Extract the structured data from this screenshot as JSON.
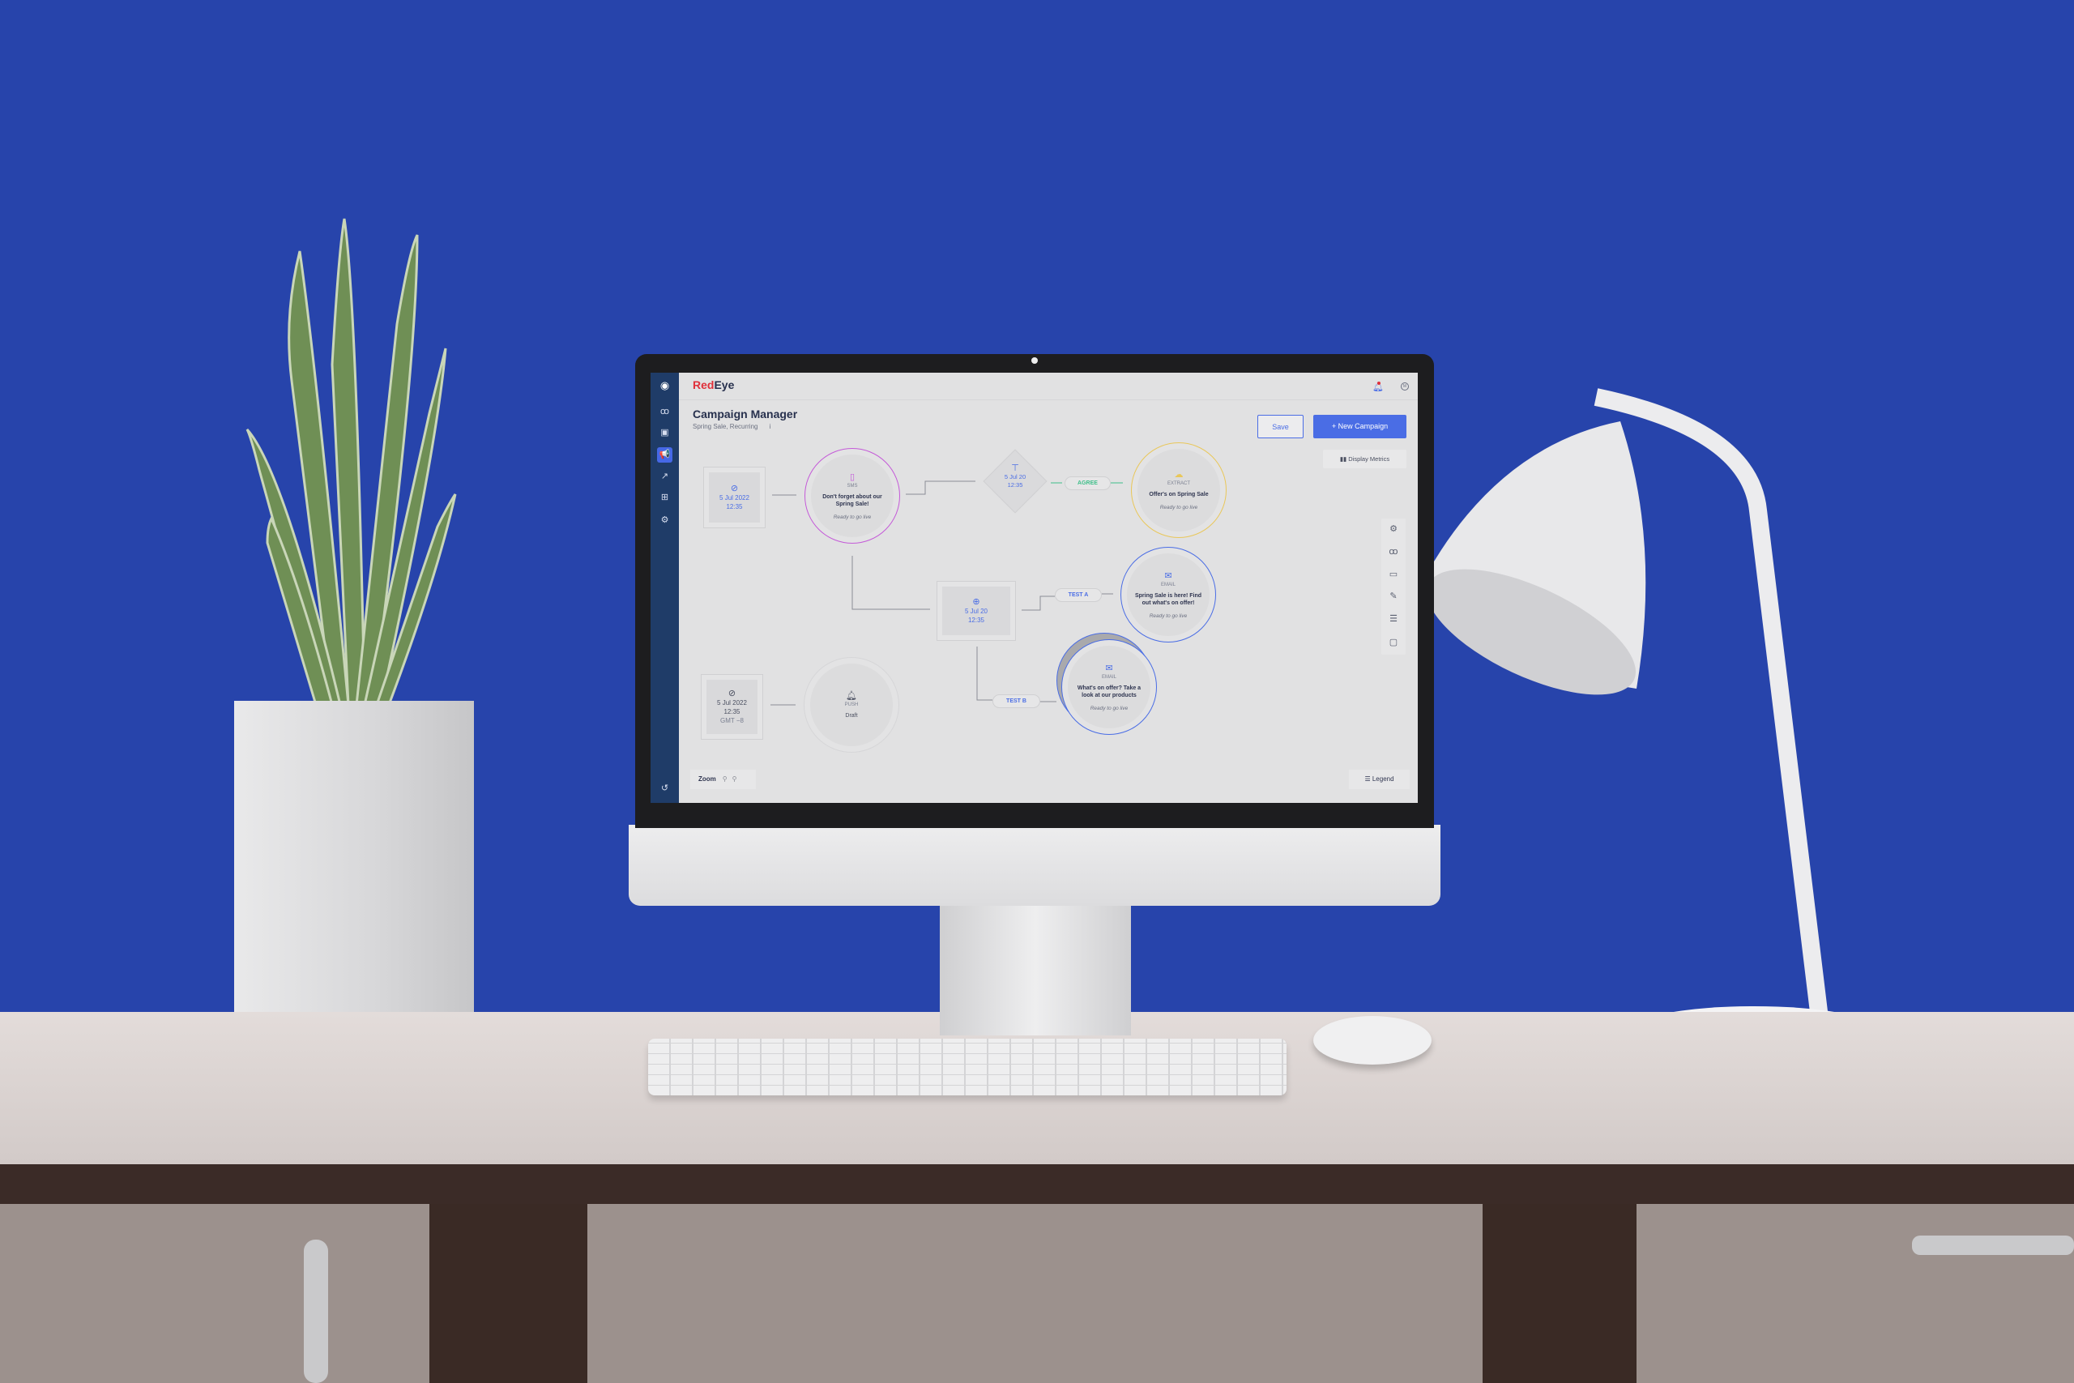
{
  "app": {
    "brand_red": "Red",
    "brand_dark": "Eye",
    "brand_red_color": "#e0303a",
    "brand_dark_color": "#27304d",
    "accent": "#4a6de5"
  },
  "header": {
    "title": "Campaign Manager",
    "subtitle": "Spring Sale, Recurring",
    "info_icon": "i",
    "avatar": "M"
  },
  "toolbar": {
    "save_label": "Save",
    "new_campaign_label": "New Campaign",
    "new_campaign_icon": "+",
    "display_metrics_label": "Display Metrics"
  },
  "sidebar": {
    "items": [
      "eye-logo",
      "audiences",
      "templates",
      "campaigns",
      "analytics",
      "integrations",
      "settings"
    ],
    "active": "campaigns",
    "bottom": "history"
  },
  "nodes": {
    "trigger1": {
      "date": "5 Jul 2022",
      "time": "12:35"
    },
    "sms": {
      "type": "SMS",
      "message": "Don't forget about our Spring Sale!",
      "status": "Ready to go live",
      "color": "#c45ad8"
    },
    "split": {
      "date": "5 Jul 20",
      "time": "12:35"
    },
    "agree": {
      "label": "AGREE",
      "color": "#3fbf8a"
    },
    "extract": {
      "type": "EXTRACT",
      "message": "Offer's on Spring Sale",
      "status": "Ready to go live",
      "color": "#e9c75a"
    },
    "abtest": {
      "date": "5 Jul 20",
      "time": "12:35"
    },
    "test_a": {
      "label": "TEST A"
    },
    "test_b": {
      "label": "TEST B"
    },
    "email1": {
      "type": "EMAIL",
      "message": "Spring Sale is here! Find out what's on offer!",
      "status": "Ready to go live",
      "color": "#4a6de5"
    },
    "email2": {
      "type": "EMAIL",
      "message": "What's on offer? Take a look at our products",
      "status": "Ready to go live",
      "color": "#4a6de5"
    },
    "trigger2": {
      "date": "5 Jul 2022",
      "time": "12:35",
      "tz": "GMT −8"
    },
    "push": {
      "type": "PUSH",
      "message": "Draft"
    }
  },
  "footer": {
    "zoom_label": "Zoom",
    "legend_label": "Legend"
  },
  "tools": [
    "gear-icon",
    "people-icon",
    "html-icon",
    "edit-doc-icon",
    "list-doc-icon",
    "file-icon"
  ]
}
